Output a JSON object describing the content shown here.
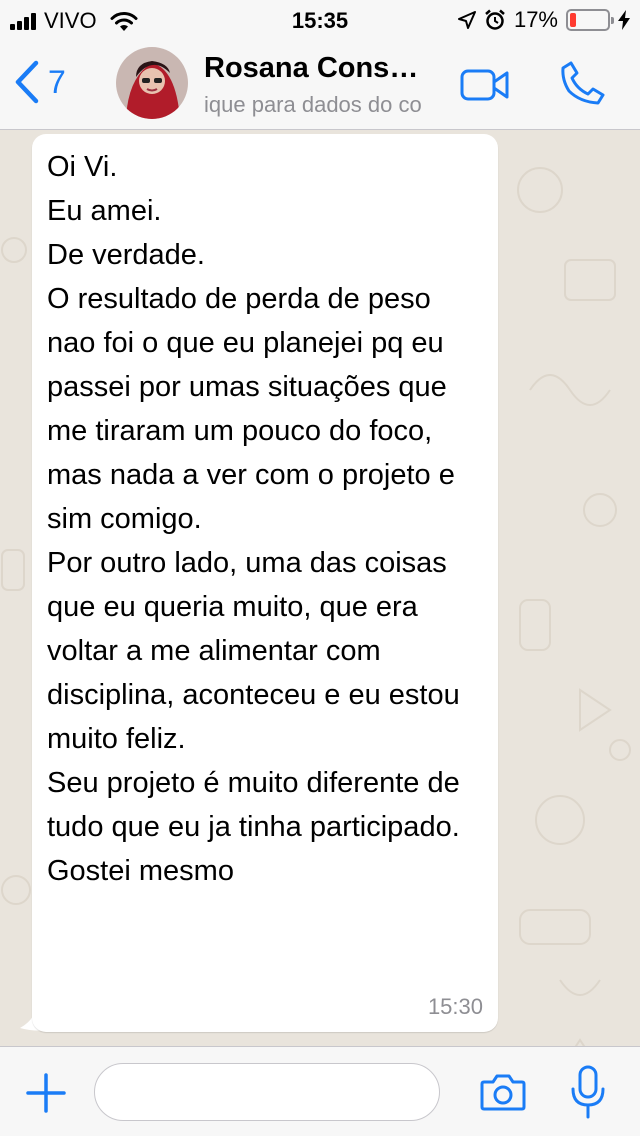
{
  "status_bar": {
    "carrier": "VIVO",
    "time": "15:35",
    "battery_percent": "17%",
    "battery_level": 0.17,
    "icons": [
      "signal-icon",
      "wifi-icon",
      "location-icon",
      "alarm-icon",
      "battery-icon",
      "charging-icon"
    ]
  },
  "header": {
    "back_count": "7",
    "contact_name": "Rosana Cons…",
    "contact_subtitle": "ique para dados do co",
    "icons": [
      "chevron-left-icon",
      "video-call-icon",
      "phone-call-icon"
    ]
  },
  "message": {
    "text": "Oi Vi.\nEu amei.\nDe verdade.\nO resultado de perda de peso nao foi o que eu planejei pq eu passei por umas situações que me tiraram um pouco do foco, mas nada a ver com o projeto e sim comigo.\nPor outro lado, uma das coisas que eu queria muito, que era voltar a me alimentar com disciplina, aconteceu e eu estou muito feliz.\nSeu projeto é muito diferente de tudo que eu ja tinha participado.\nGostei mesmo",
    "time": "15:30"
  },
  "input_bar": {
    "value": "",
    "placeholder": "",
    "icons": [
      "plus-icon",
      "camera-icon",
      "microphone-icon"
    ]
  },
  "colors": {
    "accent": "#1a7cf6",
    "chat_background": "#e9e4dc",
    "bubble": "#ffffff",
    "battery_low": "#ff3b30"
  }
}
